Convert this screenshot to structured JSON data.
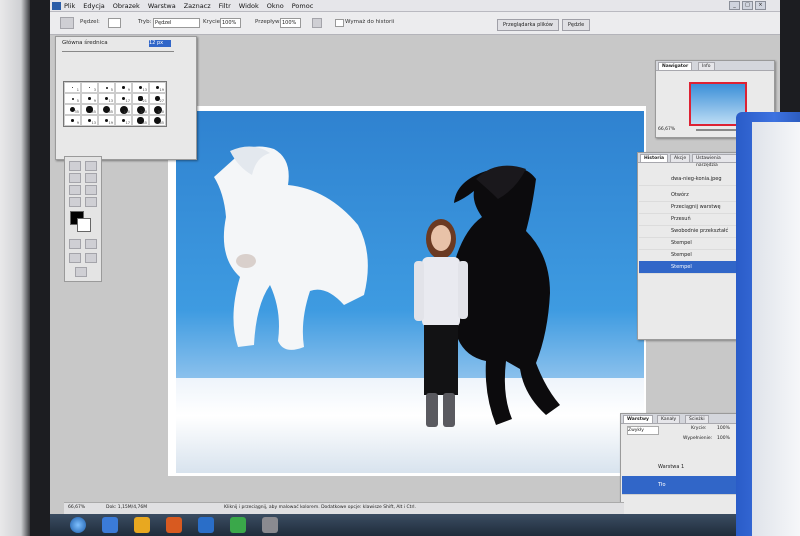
{
  "menu": {
    "items": [
      "Plik",
      "Edycja",
      "Obrazek",
      "Warstwa",
      "Zaznacz",
      "Filtr",
      "Widok",
      "Okno",
      "Pomoc"
    ]
  },
  "window_buttons": [
    "_",
    "□",
    "×"
  ],
  "options_bar": {
    "brush_label": "Pędzel:",
    "mode_label": "Tryb:",
    "mode_value": "Pędzel",
    "opacity_label": "Krycie:",
    "opacity_value": "100%",
    "flow_label": "Przepływ:",
    "flow_value": "100%",
    "checkbox_label": "Wymaż do historii",
    "tabs": [
      "Przeglądarka plików",
      "Pędzle"
    ]
  },
  "brush_panel": {
    "label": "Główna średnica",
    "value": "12 px",
    "sizes": [
      "1",
      "3",
      "5",
      "9",
      "13",
      "19",
      "5",
      "9",
      "13",
      "17",
      "21",
      "27",
      "35",
      "45",
      "65",
      "100",
      "200",
      "300",
      "9",
      "13",
      "19",
      "17",
      "45",
      "65"
    ]
  },
  "navigator": {
    "tabs": [
      "Nawigator",
      "Info"
    ],
    "zoom": "66,67%"
  },
  "history": {
    "tabs": [
      "Historia",
      "Akcje",
      "Ustawienia narzędzia"
    ],
    "snapshot": "dwa-nieg-konia.jpeg",
    "items": [
      "Otwórz",
      "Przeciągnij warstwę",
      "Przesuń",
      "Swobodnie przekształć",
      "Stempel",
      "Stempel",
      "Stempel"
    ]
  },
  "layers": {
    "tabs": [
      "Warstwy",
      "Kanały",
      "Ścieżki"
    ],
    "blend_mode": "Zwykły",
    "opacity_label": "Krycie:",
    "opacity_value": "100%",
    "fill_label": "Wypełnienie:",
    "fill_value": "100%",
    "items": [
      "Warstwa 1",
      "Tło"
    ]
  },
  "status": {
    "zoom": "66,67%",
    "doc": "Dok: 1,15M/4,76M",
    "hint": "Kliknij i przeciągnij, aby malować kolorem. Dodatkowe opcje: klawisze Shift, Alt i Ctrl."
  },
  "colors": {
    "accent": "#3166c8",
    "sky": "#3e9be1",
    "binder": "#2f62d0"
  }
}
